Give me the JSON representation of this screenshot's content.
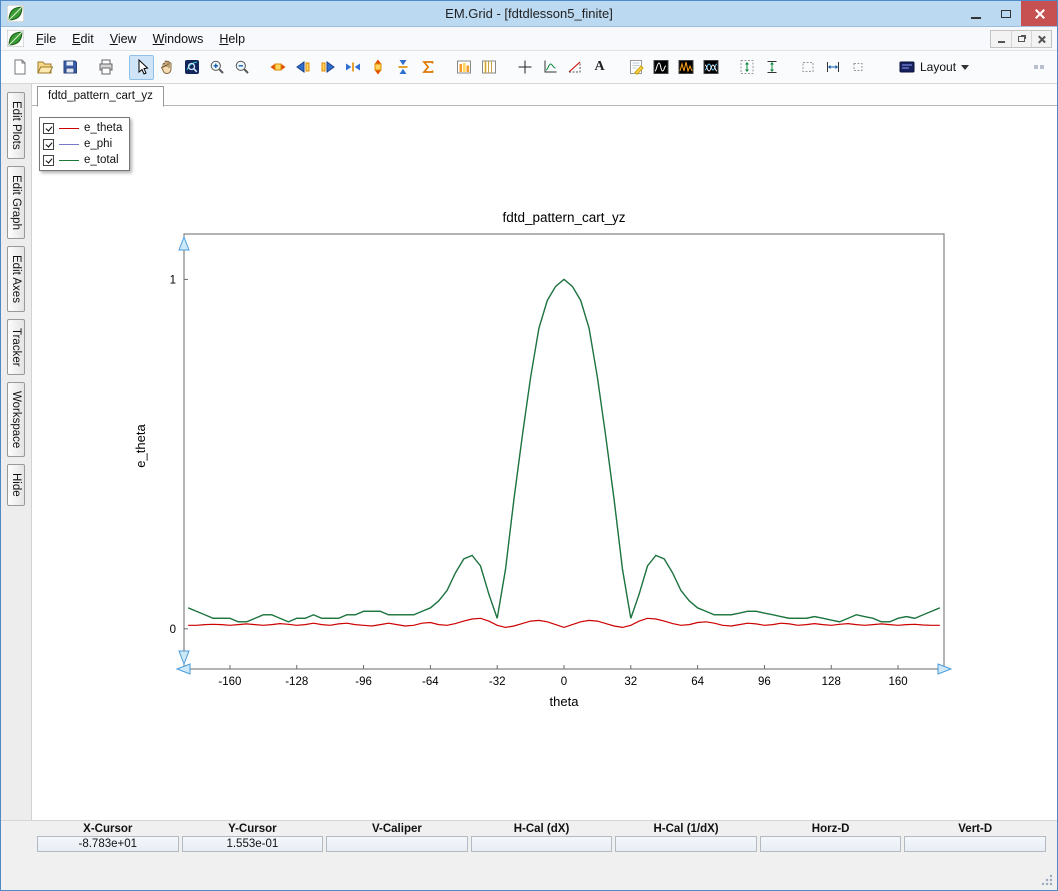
{
  "window": {
    "title": "EM.Grid - [fdtdlesson5_finite]"
  },
  "menu": {
    "items": [
      "File",
      "Edit",
      "View",
      "Windows",
      "Help"
    ]
  },
  "toolbar": {
    "a_label": "A",
    "layout_label": "Layout",
    "buttons": [
      "new-file",
      "open-file",
      "save",
      "print",
      "select",
      "pan",
      "zoom-window",
      "zoom-in",
      "zoom-out",
      "fit-width",
      "scroll-left",
      "scroll-right",
      "compress-x",
      "fit-height",
      "compress-y",
      "autoscale",
      "histogram",
      "columns",
      "crosshair",
      "axes",
      "slope",
      "text",
      "annotate",
      "fft",
      "spectrum",
      "waveforms",
      "v-caliper",
      "v-markers",
      "h-box-left",
      "h-caliper",
      "h-box-right",
      "layout",
      "toolbar-overflow"
    ]
  },
  "sidebar": {
    "items": [
      "Edit Plots",
      "Edit Graph",
      "Edit Axes",
      "Tracker",
      "Workspace",
      "Hide"
    ]
  },
  "doc_tab": {
    "label": "fdtd_pattern_cart_yz"
  },
  "legend": {
    "items": [
      {
        "label": "e_theta",
        "color": "#cc0000",
        "checked": true
      },
      {
        "label": "e_phi",
        "color": "#7878c8",
        "checked": true
      },
      {
        "label": "e_total",
        "color": "#1b7837",
        "checked": true
      }
    ]
  },
  "chart_data": {
    "type": "line",
    "title": "fdtd_pattern_cart_yz",
    "xlabel": "theta",
    "ylabel": "e_theta",
    "xlim": [
      -182,
      182
    ],
    "ylim": [
      -0.115,
      1.13
    ],
    "xticks": [
      -160,
      -128,
      -96,
      -64,
      -32,
      0,
      32,
      64,
      96,
      128,
      160
    ],
    "yticks": [
      0,
      1
    ],
    "grid": false,
    "legend_position": "top-left overlay",
    "x": [
      -180,
      -176,
      -172,
      -168,
      -164,
      -160,
      -156,
      -152,
      -148,
      -144,
      -140,
      -136,
      -132,
      -128,
      -124,
      -120,
      -116,
      -112,
      -108,
      -104,
      -100,
      -96,
      -92,
      -88,
      -84,
      -80,
      -76,
      -72,
      -68,
      -64,
      -60,
      -56,
      -52,
      -48,
      -44,
      -40,
      -36,
      -32,
      -28,
      -24,
      -20,
      -16,
      -12,
      -8,
      -4,
      0,
      4,
      8,
      12,
      16,
      20,
      24,
      28,
      32,
      36,
      40,
      44,
      48,
      52,
      56,
      60,
      64,
      68,
      72,
      76,
      80,
      84,
      88,
      92,
      96,
      100,
      104,
      108,
      112,
      116,
      120,
      124,
      128,
      132,
      136,
      140,
      144,
      148,
      152,
      156,
      160,
      164,
      168,
      172,
      176,
      180
    ],
    "series": [
      {
        "name": "e_theta",
        "color": "#cc0000",
        "values": [
          0.01,
          0.01,
          0.012,
          0.013,
          0.012,
          0.01,
          0.012,
          0.014,
          0.012,
          0.01,
          0.012,
          0.015,
          0.013,
          0.01,
          0.012,
          0.016,
          0.012,
          0.01,
          0.014,
          0.016,
          0.012,
          0.01,
          0.008,
          0.012,
          0.016,
          0.012,
          0.008,
          0.01,
          0.016,
          0.018,
          0.012,
          0.01,
          0.015,
          0.022,
          0.028,
          0.03,
          0.022,
          0.01,
          0.004,
          0.008,
          0.015,
          0.022,
          0.024,
          0.02,
          0.012,
          0.004,
          0.012,
          0.02,
          0.024,
          0.022,
          0.015,
          0.008,
          0.004,
          0.01,
          0.022,
          0.03,
          0.028,
          0.022,
          0.015,
          0.01,
          0.012,
          0.018,
          0.02,
          0.016,
          0.01,
          0.008,
          0.012,
          0.016,
          0.014,
          0.01,
          0.012,
          0.016,
          0.014,
          0.01,
          0.012,
          0.015,
          0.012,
          0.01,
          0.013,
          0.015,
          0.012,
          0.01,
          0.012,
          0.014,
          0.012,
          0.01,
          0.012,
          0.013,
          0.011,
          0.01,
          0.01
        ]
      },
      {
        "name": "e_phi",
        "color": "#7878c8",
        "values": [
          0.06,
          0.05,
          0.04,
          0.03,
          0.03,
          0.03,
          0.02,
          0.02,
          0.03,
          0.04,
          0.04,
          0.03,
          0.02,
          0.03,
          0.03,
          0.04,
          0.03,
          0.03,
          0.03,
          0.04,
          0.04,
          0.05,
          0.05,
          0.05,
          0.04,
          0.04,
          0.04,
          0.04,
          0.05,
          0.06,
          0.08,
          0.11,
          0.16,
          0.2,
          0.21,
          0.18,
          0.1,
          0.03,
          0.17,
          0.37,
          0.55,
          0.72,
          0.86,
          0.94,
          0.98,
          1.0,
          0.98,
          0.94,
          0.86,
          0.72,
          0.55,
          0.37,
          0.17,
          0.03,
          0.1,
          0.18,
          0.21,
          0.2,
          0.16,
          0.11,
          0.08,
          0.06,
          0.05,
          0.04,
          0.04,
          0.04,
          0.045,
          0.05,
          0.05,
          0.045,
          0.04,
          0.035,
          0.03,
          0.03,
          0.03,
          0.035,
          0.03,
          0.025,
          0.02,
          0.03,
          0.04,
          0.035,
          0.03,
          0.02,
          0.02,
          0.03,
          0.035,
          0.03,
          0.04,
          0.05,
          0.06
        ]
      },
      {
        "name": "e_total",
        "color": "#1b7837",
        "values": [
          0.06,
          0.05,
          0.04,
          0.03,
          0.03,
          0.03,
          0.02,
          0.02,
          0.03,
          0.04,
          0.04,
          0.03,
          0.02,
          0.03,
          0.03,
          0.04,
          0.03,
          0.03,
          0.03,
          0.04,
          0.04,
          0.05,
          0.05,
          0.05,
          0.04,
          0.04,
          0.04,
          0.04,
          0.05,
          0.06,
          0.08,
          0.11,
          0.16,
          0.2,
          0.21,
          0.18,
          0.1,
          0.03,
          0.17,
          0.37,
          0.55,
          0.72,
          0.86,
          0.94,
          0.98,
          1.0,
          0.98,
          0.94,
          0.86,
          0.72,
          0.55,
          0.37,
          0.17,
          0.03,
          0.1,
          0.18,
          0.21,
          0.2,
          0.16,
          0.11,
          0.08,
          0.06,
          0.05,
          0.04,
          0.04,
          0.04,
          0.045,
          0.05,
          0.05,
          0.045,
          0.04,
          0.035,
          0.03,
          0.03,
          0.03,
          0.035,
          0.03,
          0.025,
          0.02,
          0.03,
          0.04,
          0.035,
          0.03,
          0.02,
          0.02,
          0.03,
          0.035,
          0.03,
          0.04,
          0.05,
          0.06
        ]
      }
    ]
  },
  "status": {
    "columns": [
      {
        "header": "X-Cursor",
        "value": "-8.783e+01"
      },
      {
        "header": "Y-Cursor",
        "value": "1.553e-01"
      },
      {
        "header": "V-Caliper",
        "value": ""
      },
      {
        "header": "H-Cal (dX)",
        "value": ""
      },
      {
        "header": "H-Cal (1/dX)",
        "value": ""
      },
      {
        "header": "Horz-D",
        "value": ""
      },
      {
        "header": "Vert-D",
        "value": ""
      }
    ]
  }
}
